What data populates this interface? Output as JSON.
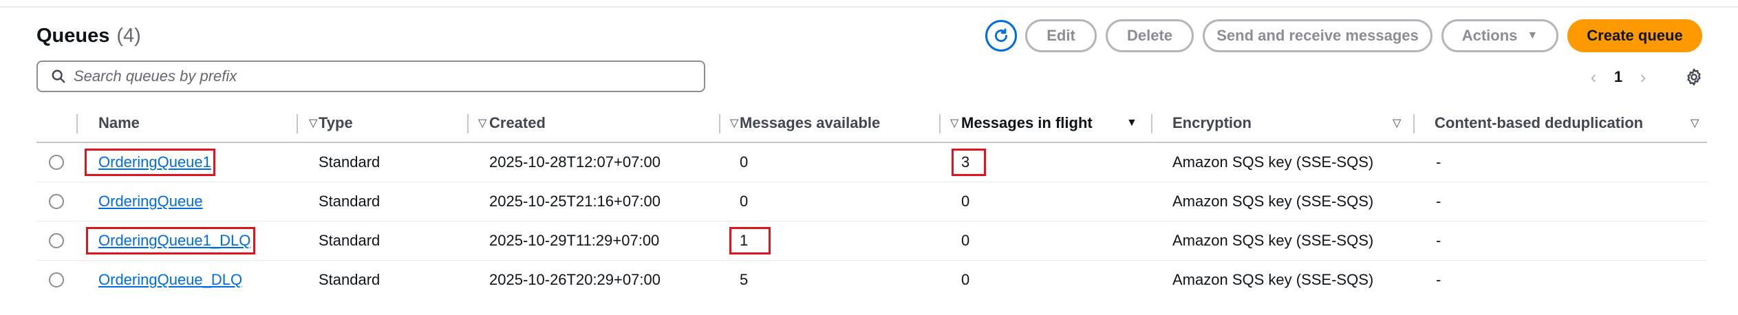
{
  "header": {
    "title": "Queues",
    "count": "(4)"
  },
  "toolbar": {
    "edit_label": "Edit",
    "delete_label": "Delete",
    "send_label": "Send and receive messages",
    "actions_label": "Actions",
    "create_label": "Create queue"
  },
  "search": {
    "placeholder": "Search queues by prefix"
  },
  "pagination": {
    "current_page": "1"
  },
  "table": {
    "columns": [
      "Name",
      "Type",
      "Created",
      "Messages available",
      "Messages in flight",
      "Encryption",
      "Content-based deduplication"
    ],
    "rows": [
      {
        "name": "OrderingQueue1",
        "type": "Standard",
        "created": "2025-10-28T12:07+07:00",
        "available": "0",
        "in_flight": "3",
        "encryption": "Amazon SQS key (SSE-SQS)",
        "dedup": "-"
      },
      {
        "name": "OrderingQueue",
        "type": "Standard",
        "created": "2025-10-25T21:16+07:00",
        "available": "0",
        "in_flight": "0",
        "encryption": "Amazon SQS key (SSE-SQS)",
        "dedup": "-"
      },
      {
        "name": "OrderingQueue1_DLQ",
        "type": "Standard",
        "created": "2025-10-29T11:29+07:00",
        "available": "1",
        "in_flight": "0",
        "encryption": "Amazon SQS key (SSE-SQS)",
        "dedup": "-"
      },
      {
        "name": "OrderingQueue_DLQ",
        "type": "Standard",
        "created": "2025-10-26T20:29+07:00",
        "available": "5",
        "in_flight": "0",
        "encryption": "Amazon SQS key (SSE-SQS)",
        "dedup": "-"
      }
    ]
  },
  "colors": {
    "link": "#006ce0",
    "primary": "#ff9900",
    "highlight": "#e0141e"
  }
}
